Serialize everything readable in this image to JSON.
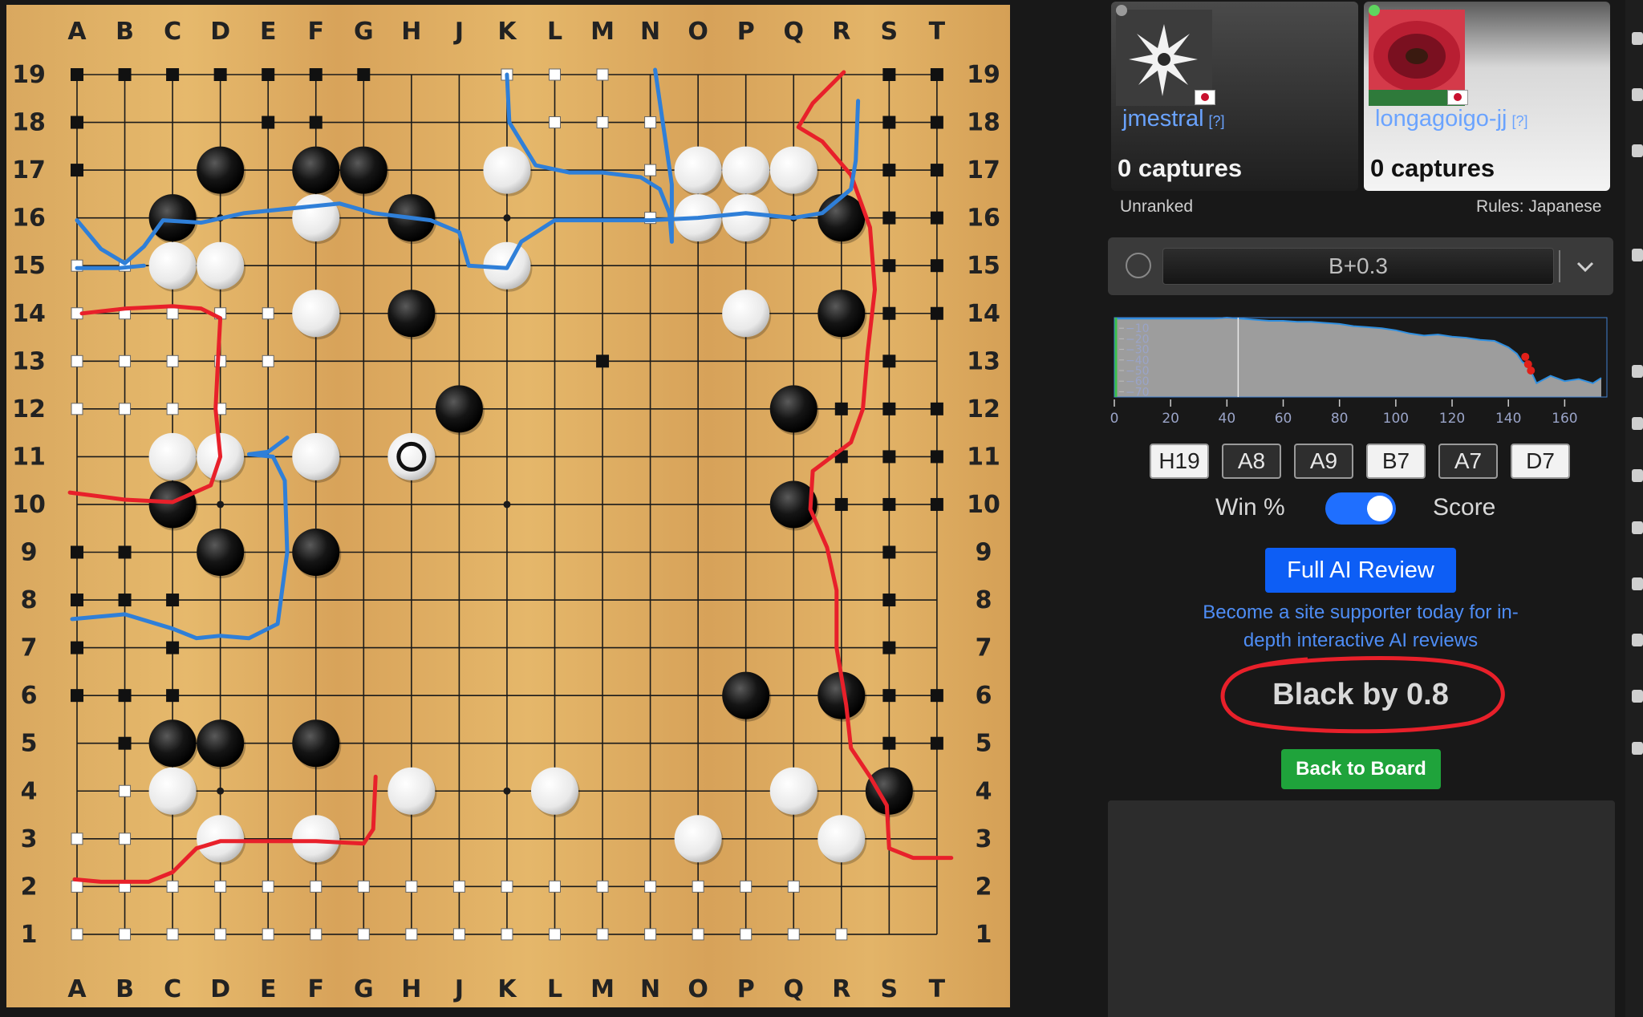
{
  "board": {
    "columns": [
      "A",
      "B",
      "C",
      "D",
      "E",
      "F",
      "G",
      "H",
      "J",
      "K",
      "L",
      "M",
      "N",
      "O",
      "P",
      "Q",
      "R",
      "S",
      "T"
    ],
    "rows": [
      19,
      18,
      17,
      16,
      15,
      14,
      13,
      12,
      11,
      10,
      9,
      8,
      7,
      6,
      5,
      4,
      3,
      2,
      1
    ],
    "last_move": "H11",
    "colors": {
      "wood": "#e2b46a",
      "line": "#1a1a1a",
      "black_territory_annotation": "#e8202a",
      "white_territory_annotation": "#2f7fd8"
    },
    "black_stones": [
      "D17",
      "F17",
      "G17",
      "C16",
      "H16",
      "R16",
      "H14",
      "R14",
      "J12",
      "Q12",
      "C10",
      "Q10",
      "D9",
      "F9",
      "P6",
      "R6",
      "C5",
      "D5",
      "F5",
      "S4"
    ],
    "white_stones": [
      "K17",
      "O17",
      "P17",
      "Q17",
      "F16",
      "O16",
      "P16",
      "C15",
      "D15",
      "K15",
      "F14",
      "P14",
      "C11",
      "D11",
      "F11",
      "C4",
      "H4",
      "L4",
      "Q4",
      "D3",
      "F3",
      "O3",
      "R3"
    ],
    "black_territory": [
      "A19",
      "B19",
      "C19",
      "D19",
      "E19",
      "F19",
      "G19",
      "A18",
      "E18",
      "F18",
      "A17",
      "S17",
      "S16",
      "S15",
      "S14",
      "S13",
      "S12",
      "S11",
      "S10",
      "R12",
      "R11",
      "R10",
      "S9",
      "S8",
      "S7",
      "S6",
      "S5",
      "A9",
      "B9",
      "A8",
      "B8",
      "C8",
      "A7",
      "C7",
      "A6",
      "B6",
      "C6",
      "T19",
      "T18",
      "T17",
      "T16",
      "T15",
      "T14",
      "T12",
      "T11",
      "T10",
      "T6",
      "T5",
      "S18",
      "S19",
      "M13",
      "B5"
    ],
    "white_territory": [
      "A15",
      "B15",
      "A14",
      "B14",
      "C14",
      "D14",
      "E14",
      "A13",
      "B13",
      "C13",
      "D13",
      "E13",
      "A12",
      "B12",
      "C12",
      "D12",
      "A1",
      "B1",
      "C1",
      "D1",
      "E1",
      "F1",
      "G1",
      "H1",
      "J1",
      "K1",
      "L1",
      "M1",
      "N1",
      "O1",
      "P1",
      "Q1",
      "R1",
      "A2",
      "B2",
      "C2",
      "D2",
      "E2",
      "F2",
      "G2",
      "H2",
      "J2",
      "K2",
      "L2",
      "M2",
      "N2",
      "O2",
      "P2",
      "Q2",
      "A3",
      "B3",
      "B4",
      "K19",
      "L19",
      "M19",
      "L18",
      "M18",
      "N18",
      "N17",
      "N16"
    ]
  },
  "players": {
    "black": {
      "name": "jmestral",
      "help": "[?]",
      "captures_label": "0 captures",
      "online_color": "#9a9a9a"
    },
    "white": {
      "name": "longagoigo-jj",
      "help": "[?]",
      "captures_label": "0 captures",
      "online_color": "#5fd45f"
    }
  },
  "meta": {
    "ranked": "Unranked",
    "rules": "Rules: Japanese"
  },
  "score_estimate": {
    "value": "B+0.3"
  },
  "chart_data": {
    "type": "area",
    "x_ticks": [
      0,
      20,
      40,
      60,
      80,
      100,
      120,
      140,
      160
    ],
    "y_ticks": [
      -10,
      -20,
      -30,
      -40,
      -50,
      -60,
      -70
    ],
    "xlim": [
      0,
      175
    ],
    "ylim": [
      -75,
      0
    ],
    "current_move_marker": 44,
    "x": [
      0,
      5,
      10,
      15,
      20,
      25,
      30,
      35,
      40,
      45,
      50,
      55,
      60,
      65,
      70,
      75,
      80,
      85,
      90,
      95,
      100,
      105,
      110,
      115,
      120,
      125,
      130,
      135,
      140,
      143,
      145,
      147,
      150,
      155,
      160,
      165,
      170,
      173
    ],
    "y": [
      -1,
      -1,
      -1,
      -1,
      -1,
      -1,
      -1,
      -1,
      0,
      -1,
      -2,
      -3,
      -3,
      -4,
      -4,
      -5,
      -6,
      -8,
      -9,
      -10,
      -12,
      -15,
      -17,
      -16,
      -18,
      -19,
      -21,
      -22,
      -28,
      -34,
      -42,
      -45,
      -62,
      -55,
      -60,
      -58,
      -62,
      -57
    ],
    "highlight_points": [
      [
        146,
        -37
      ],
      [
        147,
        -44
      ],
      [
        148,
        -50
      ]
    ],
    "colors": {
      "fill": "#9d9d9d",
      "line": "#2f8fe0",
      "marker": "#e0201a"
    }
  },
  "move_buttons": [
    {
      "label": "H19",
      "color": "white"
    },
    {
      "label": "A8",
      "color": "black"
    },
    {
      "label": "A9",
      "color": "black"
    },
    {
      "label": "B7",
      "color": "white"
    },
    {
      "label": "A7",
      "color": "black"
    },
    {
      "label": "D7",
      "color": "white"
    }
  ],
  "toggle": {
    "left_label": "Win %",
    "right_label": "Score",
    "on": true
  },
  "review_button": "Full AI Review",
  "supporter_text": "Become a site supporter today for in-depth interactive AI reviews",
  "result_text": "Black by 0.8",
  "back_button": "Back to Board"
}
